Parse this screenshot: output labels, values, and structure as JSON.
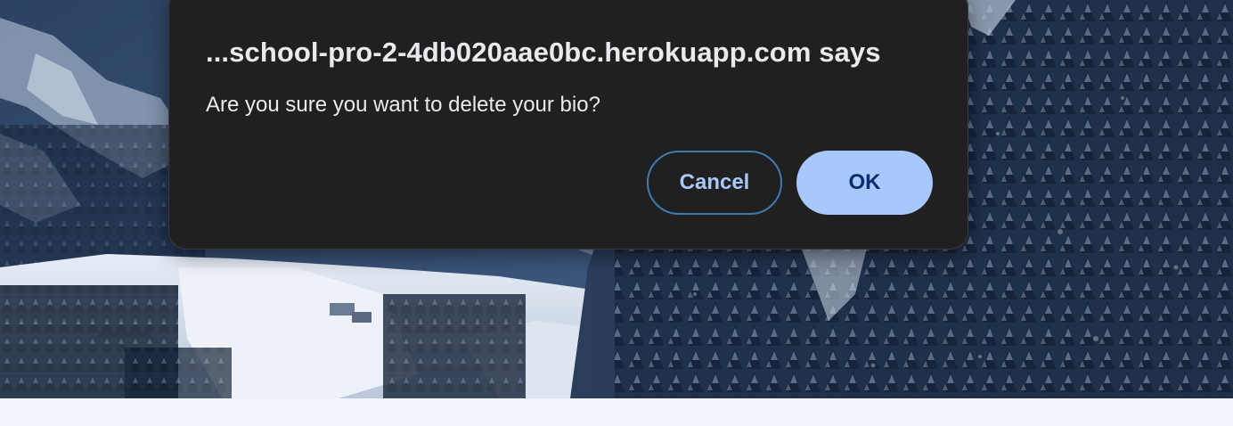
{
  "background": {
    "image": "snowy-mountain-forest",
    "sky_color": "#9fb3cc",
    "forest_color": "#1c2c42",
    "snow_color": "#dfe7f2",
    "footer_color": "#f2f5fc"
  },
  "dialog": {
    "title": "...school-pro-2-4db020aae0bc.herokuapp.com says",
    "message": "Are you sure you want to delete your bio?",
    "cancel_label": "Cancel",
    "ok_label": "OK",
    "background_color": "#202020",
    "accent_color": "#a8c7fa"
  }
}
